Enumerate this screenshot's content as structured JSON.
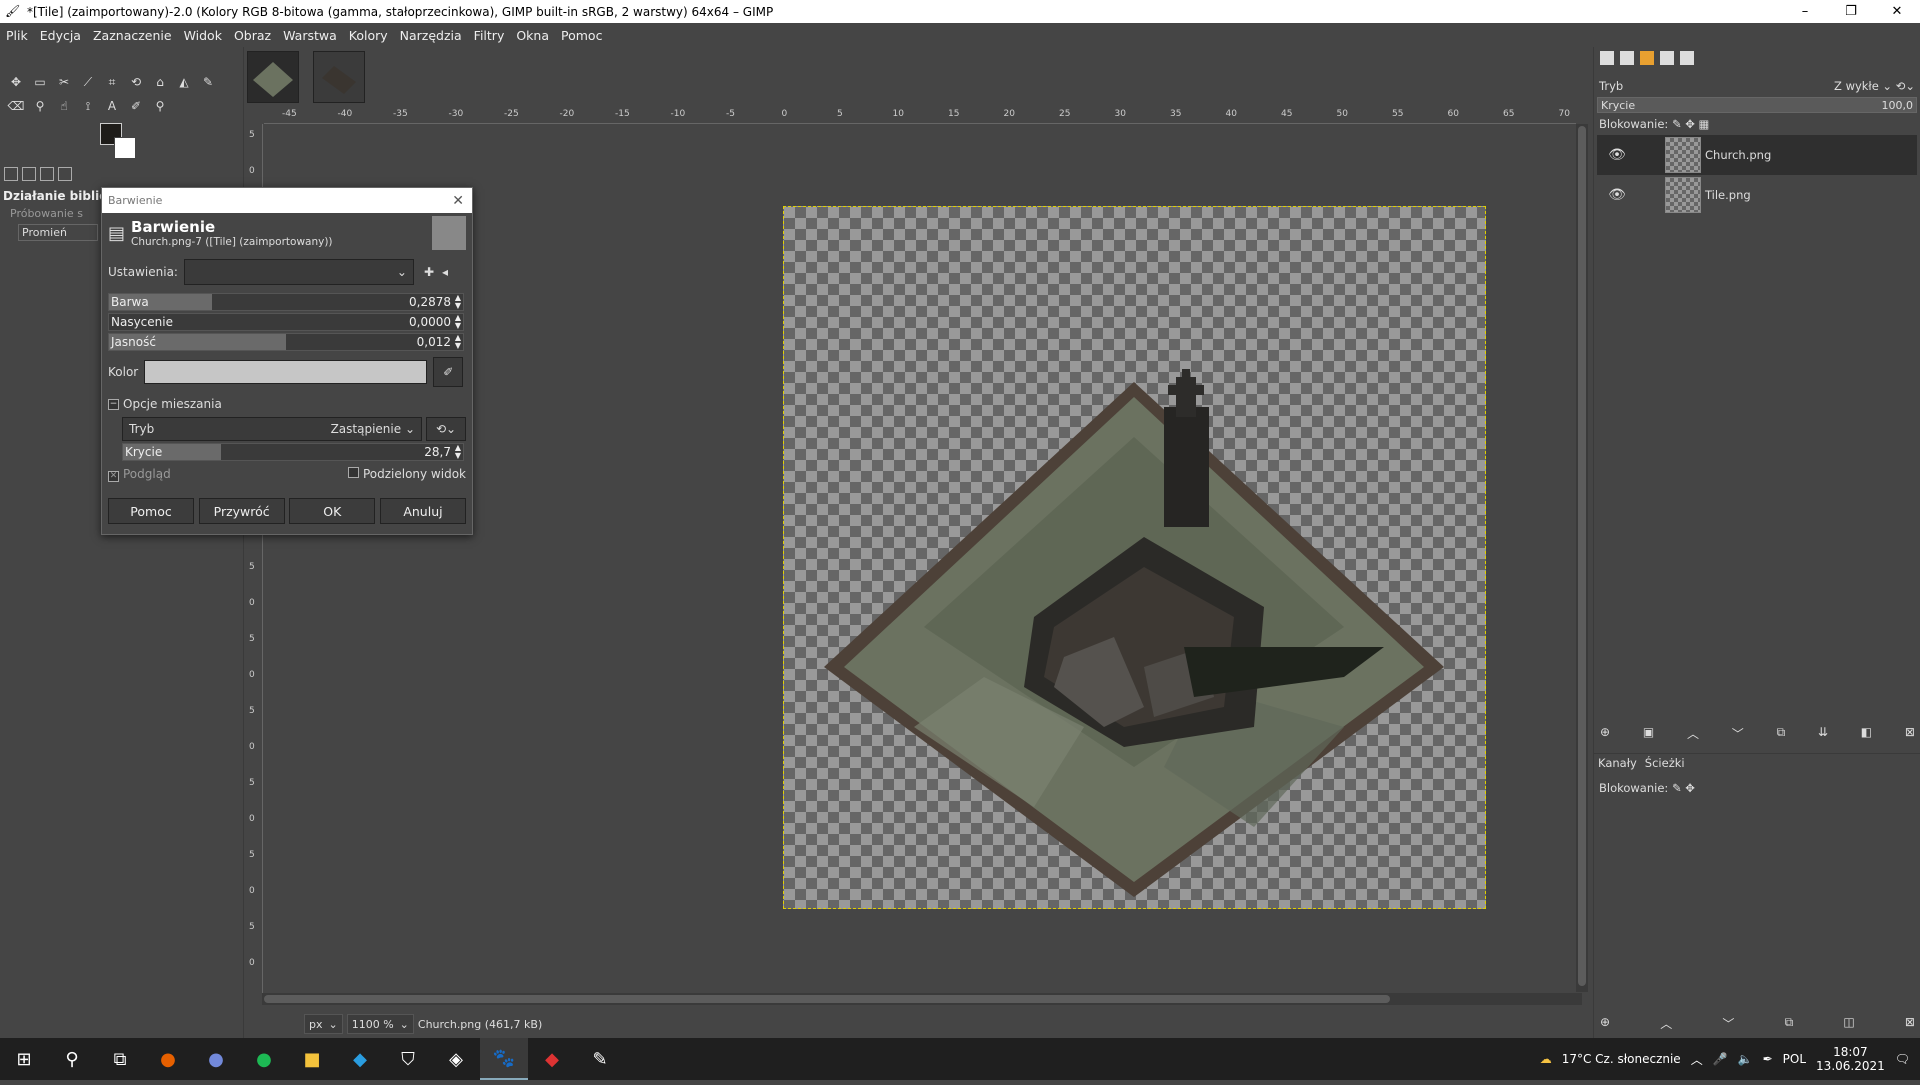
{
  "window": {
    "title": "*[Tile] (zaimportowany)-2.0 (Kolory RGB 8-bitowa (gamma, stałoprzecinkowa), GIMP built-in sRGB, 2 warstwy) 64x64 – GIMP",
    "minimize": "–",
    "maximize": "❐",
    "close": "✕"
  },
  "menu": [
    "Plik",
    "Edycja",
    "Zaznaczenie",
    "Widok",
    "Obraz",
    "Warstwa",
    "Kolory",
    "Narzędzia",
    "Filtry",
    "Okna",
    "Pomoc"
  ],
  "toolbox": {
    "dock_title": "Działanie biblio",
    "dock_item1": "Próbowanie s",
    "dock_item2": "Promień"
  },
  "rulers": {
    "h": [
      "-45",
      "-40",
      "-35",
      "-30",
      "-25",
      "-20",
      "-15",
      "-10",
      "-5",
      "0",
      "5",
      "10",
      "15",
      "20",
      "25",
      "30",
      "35",
      "40",
      "45",
      "50",
      "55",
      "60",
      "65",
      "70"
    ],
    "v": [
      "5",
      "0",
      "5",
      "0",
      "5",
      "0",
      "5",
      "0",
      "5",
      "0",
      "5",
      "0",
      "5",
      "0",
      "5",
      "0",
      "5",
      "0",
      "5",
      "0",
      "5",
      "0",
      "5",
      "0"
    ]
  },
  "status": {
    "unit": "px",
    "zoom": "1100 %",
    "info": "Church.png (461,7 kB)"
  },
  "dialog": {
    "window_title": "Barwienie",
    "heading": "Barwienie",
    "subheading": "Church.png-7 ([Tile] (zaimportowany))",
    "settings_label": "Ustawienia:",
    "hue": {
      "label": "Barwa",
      "value": "0,2878",
      "fraction": 0.29
    },
    "saturation": {
      "label": "Nasycenie",
      "value": "0,0000",
      "fraction": 0
    },
    "lightness": {
      "label": "Jasność",
      "value": "0,012",
      "fraction": 0.5
    },
    "color_label": "Kolor",
    "color_hex": "#c6c6c6",
    "blend_section": "Opcje mieszania",
    "mode_label": "Tryb",
    "mode_value": "Zastąpienie",
    "opacity": {
      "label": "Krycie",
      "value": "28,7",
      "fraction": 0.287
    },
    "preview": "Podgląd",
    "split": "Podzielony widok",
    "buttons": {
      "help": "Pomoc",
      "reset": "Przywróć",
      "ok": "OK",
      "cancel": "Anuluj"
    }
  },
  "layers": {
    "mode_label": "Tryb",
    "mode_value": "Z wykłe",
    "opacity_label": "Krycie",
    "opacity_value": "100,0",
    "lock_label": "Blokowanie:",
    "items": [
      {
        "name": "Church.png"
      },
      {
        "name": "Tile.png"
      }
    ],
    "channels_tab": "Kanały",
    "paths_tab": "Ścieżki",
    "channels_lock": "Blokowanie:"
  },
  "taskbar": {
    "weather": "17°C Cz. słonecznie",
    "lang": "POL",
    "time": "18:07",
    "date": "13.06.2021"
  }
}
